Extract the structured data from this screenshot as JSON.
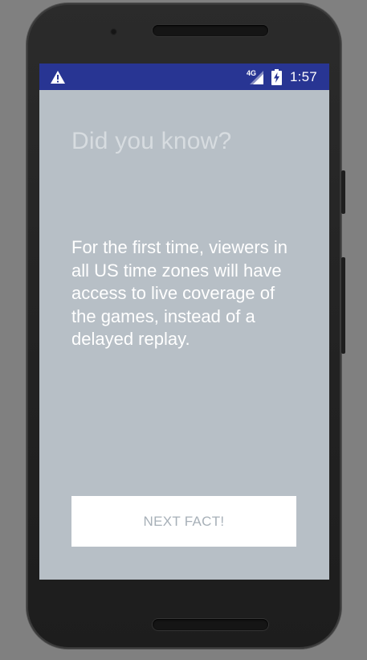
{
  "status_bar": {
    "time": "1:57",
    "network_label": "4G",
    "icons": [
      "warning-icon",
      "cell-signal-icon",
      "battery-charging-icon"
    ],
    "color": "#283593"
  },
  "main": {
    "title": "Did you know?",
    "fact": "For the first time, viewers in all US time zones will have access to live coverage of the games, instead of a delayed replay.",
    "next_button_label": "NEXT FACT!",
    "background_color": "#b7bfc6"
  }
}
